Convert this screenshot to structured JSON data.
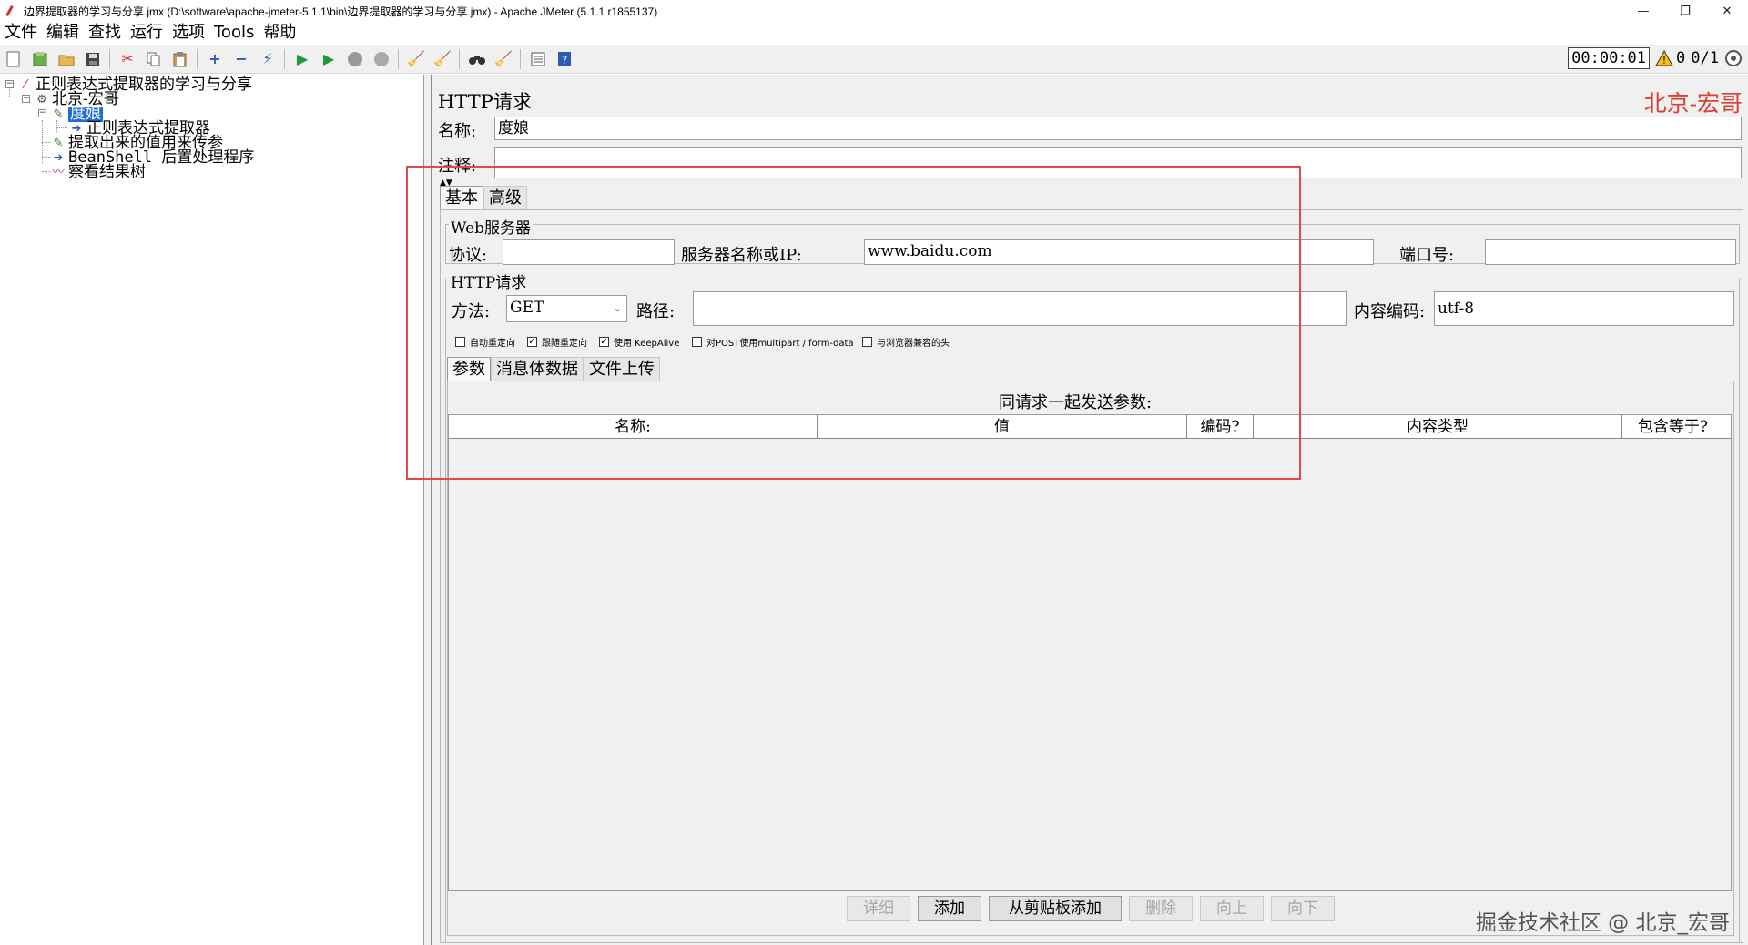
{
  "window": {
    "title": "边界提取器的学习与分享.jmx (D:\\software\\apache-jmeter-5.1.1\\bin\\边界提取器的学习与分享.jmx) - Apache JMeter (5.1.1 r1855137)",
    "minimize": "—",
    "restore": "❐",
    "close": "✕"
  },
  "menu": [
    "文件",
    "编辑",
    "查找",
    "运行",
    "选项",
    "Tools",
    "帮助"
  ],
  "toolbar": {
    "timer": "00:00:01",
    "warning_count": "0",
    "threads": "0/1"
  },
  "tree": {
    "root": "正则表达式提取器的学习与分享",
    "thread_group": "北京-宏哥",
    "sampler": "度娘",
    "sampler_child": "正则表达式提取器",
    "items": [
      "提取出来的值用来传参",
      "BeanShell 后置处理程序",
      "察看结果树"
    ]
  },
  "panel": {
    "title": "HTTP请求",
    "watermark": "北京-宏哥",
    "name_label": "名称:",
    "name_value": "度娘",
    "comment_label": "注释:",
    "tabs": [
      "基本",
      "高级"
    ],
    "web_server": {
      "title": "Web服务器",
      "protocol_label": "协议:",
      "protocol_value": "",
      "server_label": "服务器名称或IP:",
      "server_value": "www.baidu.com",
      "port_label": "端口号:",
      "port_value": ""
    },
    "http_request": {
      "title": "HTTP请求",
      "method_label": "方法:",
      "method_value": "GET",
      "path_label": "路径:",
      "path_value": "",
      "encoding_label": "内容编码:",
      "encoding_value": "utf-8"
    },
    "checkboxes": [
      {
        "label": "自动重定向",
        "checked": false
      },
      {
        "label": "跟随重定向",
        "checked": true
      },
      {
        "label": "使用 KeepAlive",
        "checked": true
      },
      {
        "label": "对POST使用multipart / form-data",
        "checked": false
      },
      {
        "label": "与浏览器兼容的头",
        "checked": false
      }
    ],
    "param_tabs": [
      "参数",
      "消息体数据",
      "文件上传"
    ],
    "params_caption": "同请求一起发送参数:",
    "columns": [
      "名称:",
      "值",
      "编码?",
      "内容类型",
      "包含等于?"
    ],
    "buttons": {
      "detail": "详细",
      "add": "添加",
      "add_clipboard": "从剪贴板添加",
      "delete": "删除",
      "up": "向上",
      "down": "向下"
    },
    "footer_watermark": "掘金技术社区 @ 北京_宏哥"
  },
  "colors": {
    "accent_red": "#e24a4a",
    "selection": "#1f6fd6"
  }
}
